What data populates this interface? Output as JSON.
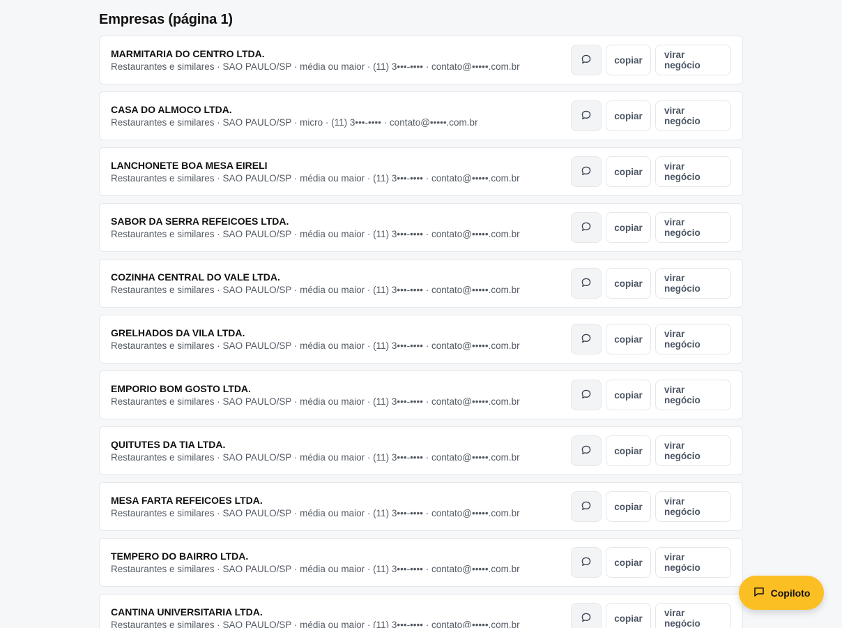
{
  "page": {
    "title": "Empresas (página 1)"
  },
  "actions": {
    "copy_label": "copiar",
    "deal_label": "virar negócio",
    "chat_icon": "chat-bubble-icon"
  },
  "companies": [
    {
      "name": "MARMITARIA DO CENTRO LTDA.",
      "meta": "Restaurantes e similares · SAO PAULO/SP · média ou maior · (11) 3•••-•••• · contato@•••••.com.br"
    },
    {
      "name": "CASA DO ALMOCO LTDA.",
      "meta": "Restaurantes e similares · SAO PAULO/SP · micro · (11) 3•••-•••• · contato@•••••.com.br"
    },
    {
      "name": "LANCHONETE BOA MESA EIRELI",
      "meta": "Restaurantes e similares · SAO PAULO/SP · média ou maior · (11) 3•••-•••• · contato@•••••.com.br"
    },
    {
      "name": "SABOR DA SERRA REFEICOES LTDA.",
      "meta": "Restaurantes e similares · SAO PAULO/SP · média ou maior · (11) 3•••-•••• · contato@•••••.com.br"
    },
    {
      "name": "COZINHA CENTRAL DO VALE LTDA.",
      "meta": "Restaurantes e similares · SAO PAULO/SP · média ou maior · (11) 3•••-•••• · contato@•••••.com.br"
    },
    {
      "name": "GRELHADOS DA VILA LTDA.",
      "meta": "Restaurantes e similares · SAO PAULO/SP · média ou maior · (11) 3•••-•••• · contato@•••••.com.br"
    },
    {
      "name": "EMPORIO BOM GOSTO LTDA.",
      "meta": "Restaurantes e similares · SAO PAULO/SP · média ou maior · (11) 3•••-•••• · contato@•••••.com.br"
    },
    {
      "name": "QUITUTES DA TIA LTDA.",
      "meta": "Restaurantes e similares · SAO PAULO/SP · média ou maior · (11) 3•••-•••• · contato@•••••.com.br"
    },
    {
      "name": "MESA FARTA REFEICOES LTDA.",
      "meta": "Restaurantes e similares · SAO PAULO/SP · média ou maior · (11) 3•••-•••• · contato@•••••.com.br"
    },
    {
      "name": "TEMPERO DO BAIRRO LTDA.",
      "meta": "Restaurantes e similares · SAO PAULO/SP · média ou maior · (11) 3•••-•••• · contato@•••••.com.br"
    },
    {
      "name": "CANTINA UNIVERSITARIA LTDA.",
      "meta": "Restaurantes e similares · SAO PAULO/SP · média ou maior · (11) 3•••-•••• · contato@•••••.com.br"
    }
  ],
  "copilot": {
    "label": "Copiloto",
    "icon": "chat-square-icon",
    "color": "#fbbf24"
  }
}
